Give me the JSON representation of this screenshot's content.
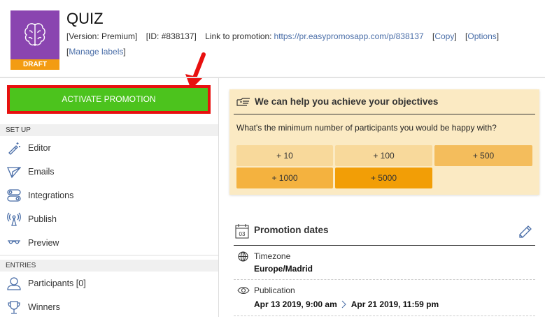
{
  "header": {
    "title": "QUIZ",
    "status_badge": "DRAFT",
    "version": "[Version: Premium]",
    "id": "[ID: #838137]",
    "link_label": "Link to promotion:",
    "link_url": "https://pr.easypromosapp.com/p/838137",
    "copy_label": "Copy",
    "options_label": "Options",
    "manage_labels": "Manage labels",
    "logo_color": "#8a45b0",
    "badge_color": "#f39c12"
  },
  "sidebar": {
    "activate_label": "ACTIVATE PROMOTION",
    "activate_color": "#4cc31d",
    "sections": [
      {
        "title": "SET UP",
        "items": [
          {
            "label": "Editor",
            "icon": "magic-wand-icon"
          },
          {
            "label": "Emails",
            "icon": "paper-plane-icon"
          },
          {
            "label": "Integrations",
            "icon": "toggles-icon"
          },
          {
            "label": "Publish",
            "icon": "antenna-icon"
          },
          {
            "label": "Preview",
            "icon": "glasses-icon"
          }
        ]
      },
      {
        "title": "ENTRIES",
        "items": [
          {
            "label": "Participants [0]",
            "icon": "user-icon"
          },
          {
            "label": "Winners",
            "icon": "trophy-icon"
          }
        ]
      }
    ]
  },
  "objectives": {
    "title": "We can help you achieve your objectives",
    "question": "What's the minimum number of participants you would be happy with?",
    "options": [
      {
        "label": "+ 10",
        "color": "#f8d99b"
      },
      {
        "label": "+ 100",
        "color": "#f8d99b"
      },
      {
        "label": "+ 500",
        "color": "#f4bd5c"
      },
      {
        "label": "+ 1000",
        "color": "#f4b23f"
      },
      {
        "label": "+ 5000",
        "color": "#f29e06"
      }
    ]
  },
  "dates": {
    "title": "Promotion dates",
    "calendar_day": "03",
    "timezone_label": "Timezone",
    "timezone_value": "Europe/Madrid",
    "publication_label": "Publication",
    "publication_start": "Apr 13 2019, 9:00 am",
    "publication_end": "Apr 21 2019, 11:59 pm"
  }
}
